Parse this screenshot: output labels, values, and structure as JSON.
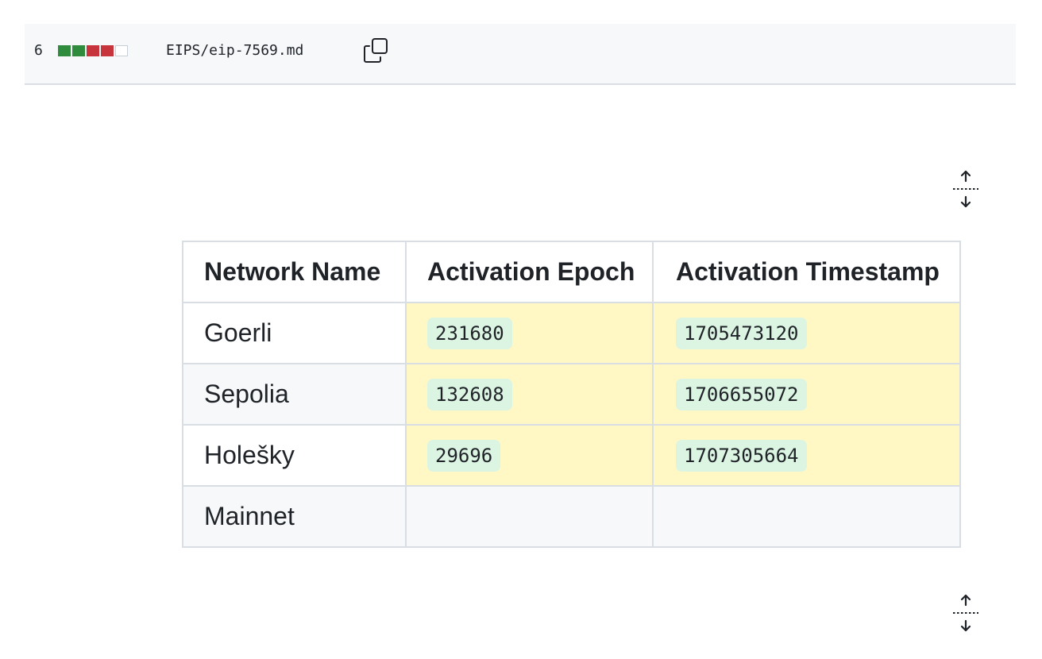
{
  "file": {
    "change_count": "6",
    "path": "EIPS/eip-7569.md",
    "diffstat": [
      "add",
      "add",
      "del",
      "del",
      "neutral"
    ]
  },
  "icons": {
    "copy": "copy-icon",
    "expand": "unfold-icon"
  },
  "table": {
    "headers": [
      "Network Name",
      "Activation Epoch",
      "Activation Timestamp"
    ],
    "rows": [
      {
        "network": "Goerli",
        "epoch": "231680",
        "timestamp": "1705473120"
      },
      {
        "network": "Sepolia",
        "epoch": "132608",
        "timestamp": "1706655072"
      },
      {
        "network": "Holešky",
        "epoch": "29696",
        "timestamp": "1707305664"
      },
      {
        "network": "Mainnet",
        "epoch": "",
        "timestamp": ""
      }
    ]
  },
  "colors": {
    "addition": "#2f8c3d",
    "deletion": "#c8343b",
    "changed_cell": "#fff8c5",
    "code_highlight": "#dcf5e3"
  }
}
